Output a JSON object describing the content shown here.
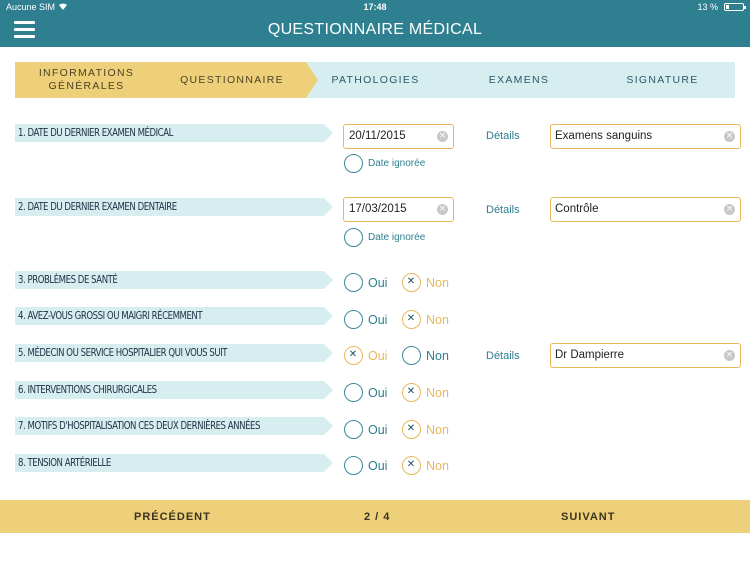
{
  "status": {
    "carrier": "Aucune SIM",
    "time": "17:48",
    "battery": "13 %"
  },
  "header": {
    "title": "QUESTIONNAIRE MÉDICAL"
  },
  "stepper": {
    "steps": [
      {
        "label": "INFORMATIONS GÉNÉRALES"
      },
      {
        "label": "QUESTIONNAIRE"
      },
      {
        "label": "PATHOLOGIES"
      },
      {
        "label": "EXAMENS"
      },
      {
        "label": "SIGNATURE"
      }
    ]
  },
  "common": {
    "details_label": "Détails",
    "date_ignored_label": "Date ignorée",
    "yes_label": "Oui",
    "no_label": "Non"
  },
  "questions": [
    {
      "label": "1. DATE DU DERNIER EXAMEN MÉDICAL",
      "date": "20/11/2015",
      "details": "Examens sanguins",
      "date_ignored": false
    },
    {
      "label": "2. DATE DU DERNIER EXAMEN DENTAIRE",
      "date": "17/03/2015",
      "details": "Contrôle",
      "date_ignored": false
    },
    {
      "label": "3. PROBLÈMES DE SANTÉ",
      "answer": "Non"
    },
    {
      "label": "4. AVEZ-VOUS GROSSI OU MAIGRI RÉCEMMENT",
      "answer": "Non"
    },
    {
      "label": "5. MÉDECIN OU SERVICE HOSPITALIER QUI VOUS SUIT",
      "answer": "Oui",
      "details": "Dr Dampierre"
    },
    {
      "label": "6. INTERVENTIONS CHIRURGICALES",
      "answer": "Non"
    },
    {
      "label": "7. MOTIFS D'HOSPITALISATION CES DEUX DERNIÈRES ANNÉES",
      "answer": "Non"
    },
    {
      "label": "8. TENSION ARTÉRIELLE",
      "answer": "Non"
    }
  ],
  "footer": {
    "prev_label": "PRÉCÉDENT",
    "page_indicator": "2 / 4",
    "next_label": "SUIVANT"
  },
  "colors": {
    "primary": "#2e7f8f",
    "accent": "#efd07a",
    "step_bg": "#d7eef1",
    "input_border": "#e6b85a"
  }
}
